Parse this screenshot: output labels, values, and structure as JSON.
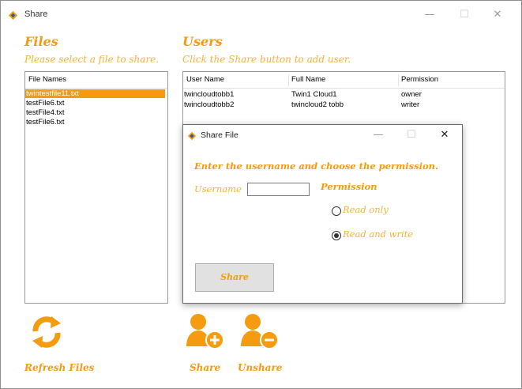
{
  "window": {
    "title": "Share",
    "minimize": "—",
    "maximize": "☐",
    "close": "✕"
  },
  "files": {
    "heading": "Files",
    "subheading": "Please select a file to share.",
    "column": "File Names",
    "items": [
      "twintestfile11.txt",
      "testFile6.txt",
      "testFile4.txt",
      "testFile6.txt"
    ],
    "selected_index": 0
  },
  "users": {
    "heading": "Users",
    "subheading": "Click the Share button to add user.",
    "columns": [
      "User Name",
      "Full Name",
      "Permission"
    ],
    "rows": [
      [
        "twincloudtobb1",
        "Twin1 Cloud1",
        "owner"
      ],
      [
        "twincloudtobb2",
        "twincloud2 tobb",
        "writer"
      ]
    ]
  },
  "dialog": {
    "title": "Share File",
    "minimize": "—",
    "maximize": "☐",
    "close": "✕",
    "instruction": "Enter the username and choose the permission.",
    "username_label": "Username",
    "username_value": "",
    "permission_label": "Permission",
    "options": [
      "Read only",
      "Read and write"
    ],
    "selected_option": 1,
    "share_button": "Share"
  },
  "actions": {
    "refresh": "Refresh Files",
    "share": "Share",
    "unshare": "Unshare"
  },
  "colors": {
    "accent": "#f49b10",
    "accent_light": "#f4b23c",
    "selection": "#f49b10"
  }
}
